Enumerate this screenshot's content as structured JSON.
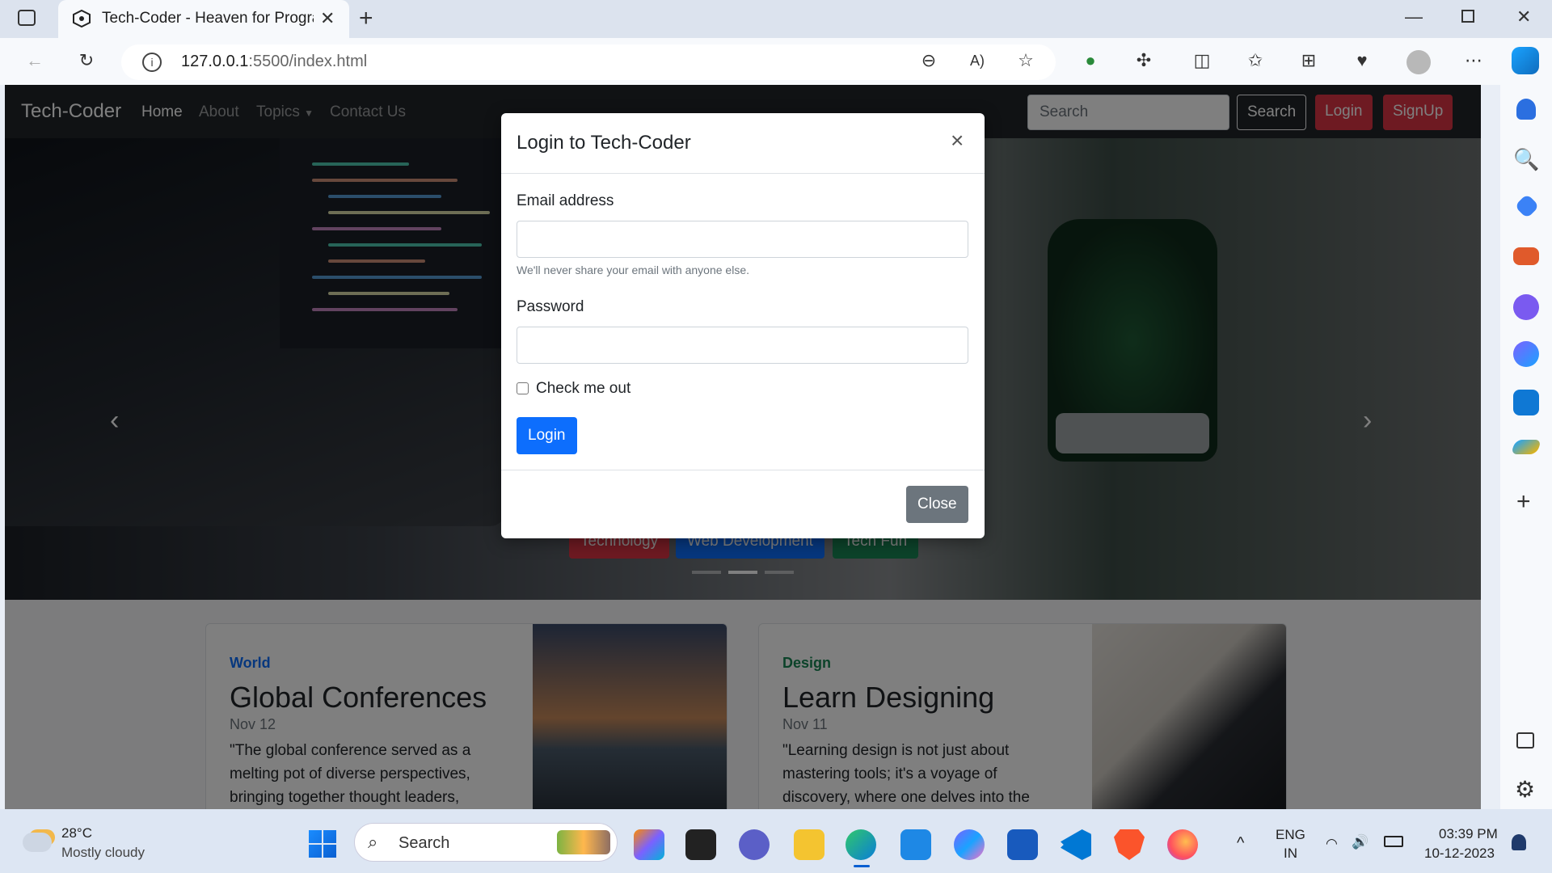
{
  "browser": {
    "tab_title": "Tech-Coder - Heaven for Programmers",
    "url_host": "127.0.0.1",
    "url_path": ":5500/index.html"
  },
  "navbar": {
    "brand": "Tech-Coder",
    "links": [
      "Home",
      "About",
      "Topics",
      "Contact Us"
    ],
    "search_placeholder": "Search",
    "search_button": "Search",
    "login_button": "Login",
    "signup_button": "SignUp"
  },
  "hero": {
    "categories": [
      "Technology",
      "Web Development",
      "Tech Fun"
    ]
  },
  "cards": [
    {
      "category": "World",
      "title": "Global Conferences",
      "date": "Nov 12",
      "text": "\"The global conference served as a melting pot of diverse perspectives, bringing together thought leaders,"
    },
    {
      "category": "Design",
      "title": "Learn Designing",
      "date": "Nov 11",
      "text": "\"Learning design is not just about mastering tools; it's a voyage of discovery, where one delves into the"
    }
  ],
  "modal": {
    "title": "Login to Tech-Coder",
    "close_x": "×",
    "email_label": "Email address",
    "email_help": "We'll never share your email with anyone else.",
    "password_label": "Password",
    "check_label": "Check me out",
    "login_button": "Login",
    "close_button": "Close"
  },
  "taskbar": {
    "temperature": "28°C",
    "weather": "Mostly cloudy",
    "search": "Search",
    "lang1": "ENG",
    "lang2": "IN",
    "time": "03:39 PM",
    "date": "10-12-2023"
  },
  "colors": {
    "primary": "#0d6efd",
    "danger": "#dc3545",
    "success": "#198754",
    "secondary": "#6c757d",
    "dark": "#212529"
  }
}
